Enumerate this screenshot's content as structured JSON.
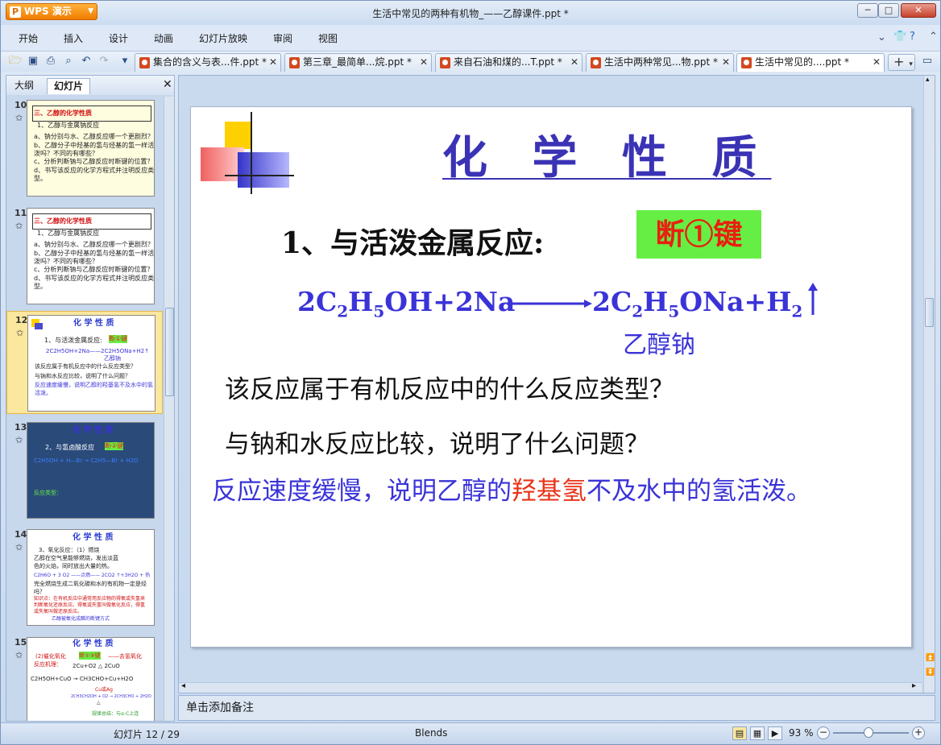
{
  "app": {
    "name": "WPS 演示",
    "window_title": "生活中常见的两种有机物_——乙醇课件.ppt *"
  },
  "menu": [
    "开始",
    "插入",
    "设计",
    "动画",
    "幻灯片放映",
    "审阅",
    "视图"
  ],
  "tabs": [
    {
      "label": "集合的含义与表...件.ppt *",
      "active": false
    },
    {
      "label": "第三章_最简单...烷.ppt *",
      "active": false
    },
    {
      "label": "来自石油和煤的...T.ppt *",
      "active": false
    },
    {
      "label": "生活中两种常见...物.ppt *",
      "active": false
    },
    {
      "label": "生活中常见的....ppt *",
      "active": true
    }
  ],
  "panel": {
    "tab_outline": "大纲",
    "tab_slides": "幻灯片"
  },
  "thumbs": [
    {
      "num": "10",
      "title": "三、乙醇的化学性质",
      "lines": [
        "1、乙醇与金属钠反应",
        "a、钠分别与水、乙醇反应哪一个更剧烈？",
        "b、乙醇分子中羟基的氢与烃基的氢一样活泼吗？不同的有哪些？",
        "c、分析判断钠与乙醇反应时断键的位置？",
        "d、书写该反应的化学方程式并注明反应类型。"
      ]
    },
    {
      "num": "11",
      "title": "三、乙醇的化学性质",
      "lines": [
        "1、乙醇与金属钠反应",
        "a、钠分别与水、乙醇反应哪一个更剧烈？",
        "b、乙醇分子中羟基的氢与烃基的氢一样活泼吗？不同的有哪些？",
        "c、分析判断钠与乙醇反应时断键的位置？",
        "d、书写该反应的化学方程式并注明反应类型。"
      ]
    },
    {
      "num": "12",
      "title": "化 学 性 质",
      "lines": [
        "1、与活泼金属反应:",
        "断①键",
        "2C2H5OH+2Na——2C2H5ONa+H2↑",
        "乙醇钠",
        "该反应属于有机反应中的什么反应类型？",
        "与钠和水反应比较，说明了什么问题？",
        "反应速度缓慢，说明乙醇的羟基氢不及水中的氢活泼。"
      ]
    },
    {
      "num": "13",
      "title": "化 学 性 质",
      "lines": [
        "2、与氢卤酸反应",
        "断②键",
        "C2H5OH + H—Br → C2H5—Br + H2O",
        "反应类型："
      ]
    },
    {
      "num": "14",
      "title": "化 学 性 质",
      "lines": [
        "3、氧化反应：（1）燃烧",
        "乙醇在空气里能够燃烧，发出淡蓝色的火焰，同时放出大量的热。",
        "C2H6O + 3 O2 ——点燃—— 2CO2 ↑+3H2O + 热",
        "完全燃烧生成二氧化碳和水的有机物一定是烃吗？",
        "知识点：在有机反应中通常用反应物的得氧或失氢来判断氧化还原反应。得氧或失氢叫做氧化反应，得氢或失氧叫做还原反应。",
        "乙醇被氧化成醛的断键方式"
      ]
    },
    {
      "num": "15",
      "title": "化 学 性 质",
      "lines": [
        "(2)催化氧化",
        "断①③键",
        "——去氢氧化",
        "反应机理：",
        "2Cu+O2 △ 2CuO",
        "C2H5OH+CuO → CH3CHO+Cu+H2O",
        "Cu或Ag",
        "2CH3CH2OH + O2 → 2CH3CHO + 2H2O",
        "△",
        "规律总结：与α-C上连"
      ]
    }
  ],
  "slide": {
    "title": "化 学 性 质",
    "heading": "1、与活泼金属反应:",
    "tag": "断①键",
    "eq_left": [
      "2C",
      "2",
      "H",
      "5",
      "OH+2Na"
    ],
    "eq_right": [
      "2C",
      "2",
      "H",
      "5",
      "ONa+H",
      "2"
    ],
    "ethoxide": "乙醇钠",
    "q1": "该反应属于有机反应中的什么反应类型？",
    "q2": "与钠和水反应比较，说明了什么问题？",
    "answer_a": "反应速度缓慢，说明乙醇的",
    "answer_hl": "羟基氢",
    "answer_b": "不及水中的氢活泼。"
  },
  "notes_placeholder": "单击添加备注",
  "status": {
    "slide_info": "幻灯片 12 / 29",
    "theme": "Blends",
    "zoom": "93 %"
  },
  "colors": {
    "accent": "#3a33b5",
    "tag_bg": "#66ee44",
    "highlight": "#e83218"
  }
}
